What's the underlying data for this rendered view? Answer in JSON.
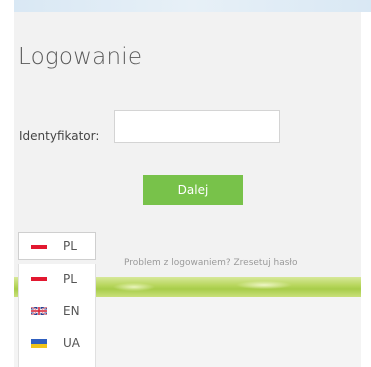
{
  "login": {
    "title": "Logowanie",
    "id_label": "Identyfikator:",
    "id_value": "",
    "id_placeholder": "",
    "submit_label": "Dalej",
    "help_link": "Problem z logowaniem? Zresetuj hasło"
  },
  "language": {
    "selected": {
      "code": "PL",
      "flag": "flag-pl-icon"
    },
    "options": [
      {
        "code": "PL",
        "flag": "flag-pl-icon"
      },
      {
        "code": "EN",
        "flag": "flag-gb-icon"
      },
      {
        "code": "UA",
        "flag": "flag-ua-icon"
      }
    ]
  },
  "colors": {
    "accent": "#78c24a",
    "panel": "#f2f2f2",
    "title": "#5a5a5a"
  }
}
